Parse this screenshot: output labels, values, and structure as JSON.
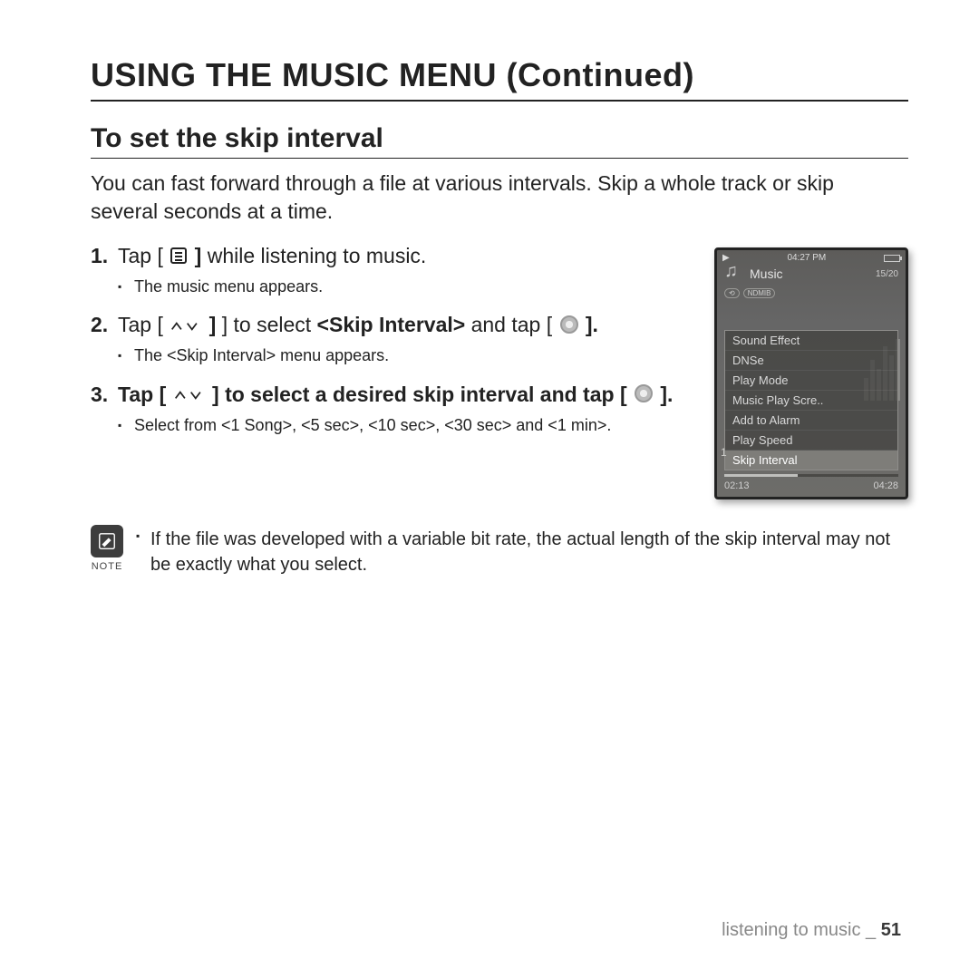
{
  "page": {
    "title": "USING THE MUSIC MENU (Continued)",
    "section_title": "To set the skip interval",
    "intro": "You can fast forward through a file at various intervals. Skip a whole track or skip several seconds at a time."
  },
  "steps": [
    {
      "pre": "Tap [",
      "post": "] while listening to music.",
      "sub": "The music menu appears."
    },
    {
      "pre": "Tap [",
      "mid1": "] to select ",
      "bold": "<Skip Interval>",
      "mid2": " and tap [",
      "post": "].",
      "sub": "The <Skip Interval> menu appears."
    },
    {
      "pre": "Tap [",
      "mid": "] to select a desired skip interval and tap [",
      "post": "].",
      "sub": "Select from <1 Song>, <5 sec>, <10 sec>, <30 sec> and <1 min>."
    }
  ],
  "note": {
    "label": "NOTE",
    "text": "If the file was developed with a variable bit rate, the actual length of the skip interval may not be exactly what you select."
  },
  "device": {
    "time": "04:27 PM",
    "header_label": "Music",
    "count": "15/20",
    "repeat_tag": "NDMIB",
    "menu": [
      "Sound Effect",
      "DNSe",
      "Play Mode",
      "Music Play Scre..",
      "Add to Alarm",
      "Play Speed",
      "Skip Interval"
    ],
    "selected_index": 6,
    "left_num": "1",
    "time_left": "02:13",
    "time_right": "04:28"
  },
  "footer": {
    "chapter": "listening to music",
    "sep": " _ ",
    "page_number": "51"
  }
}
